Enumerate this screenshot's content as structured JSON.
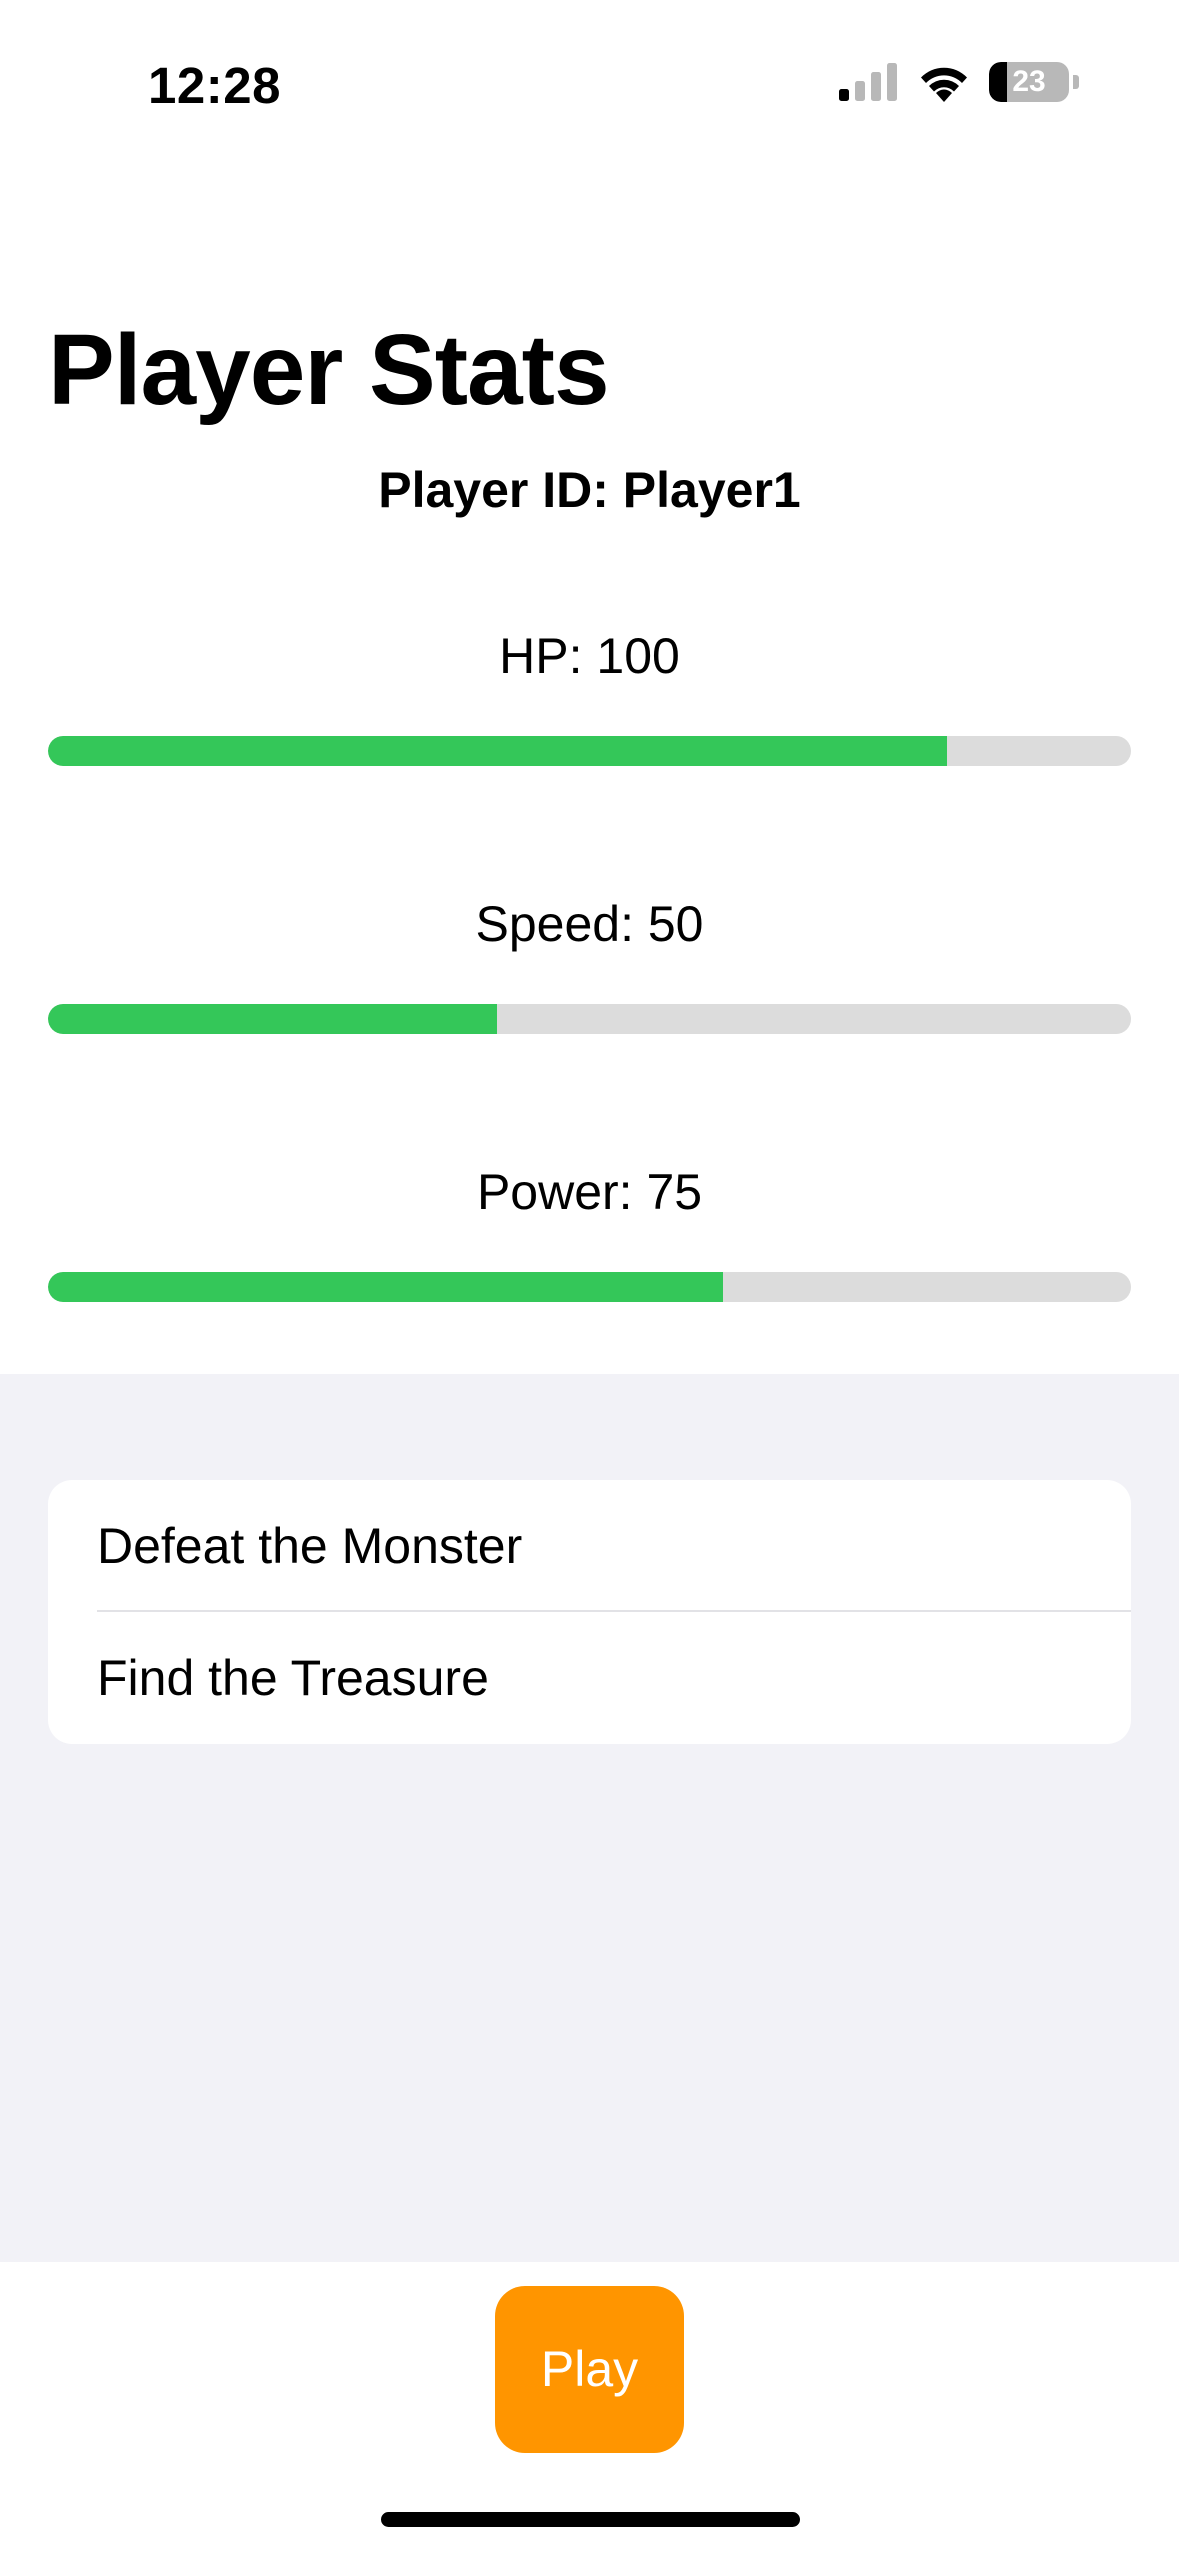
{
  "status_bar": {
    "time": "12:28",
    "battery_level": "23",
    "battery_fraction": 0.23,
    "icons": [
      "cellular-signal-icon",
      "wifi-icon",
      "battery-icon"
    ]
  },
  "header": {
    "title": "Player Stats",
    "player_id": "Player ID: Player1"
  },
  "stats": [
    {
      "label": "HP: 100",
      "fraction": 0.83
    },
    {
      "label": "Speed: 50",
      "fraction": 0.415
    },
    {
      "label": "Power: 75",
      "fraction": 0.623
    }
  ],
  "quests": [
    {
      "label": "Defeat the Monster"
    },
    {
      "label": "Find the Treasure"
    }
  ],
  "play_button": {
    "label": "Play"
  },
  "colors": {
    "bar_fill": "#34c759",
    "bar_track": "#dcdcdc",
    "play_button": "#ff9500",
    "grouped_background": "#f2f2f7"
  }
}
